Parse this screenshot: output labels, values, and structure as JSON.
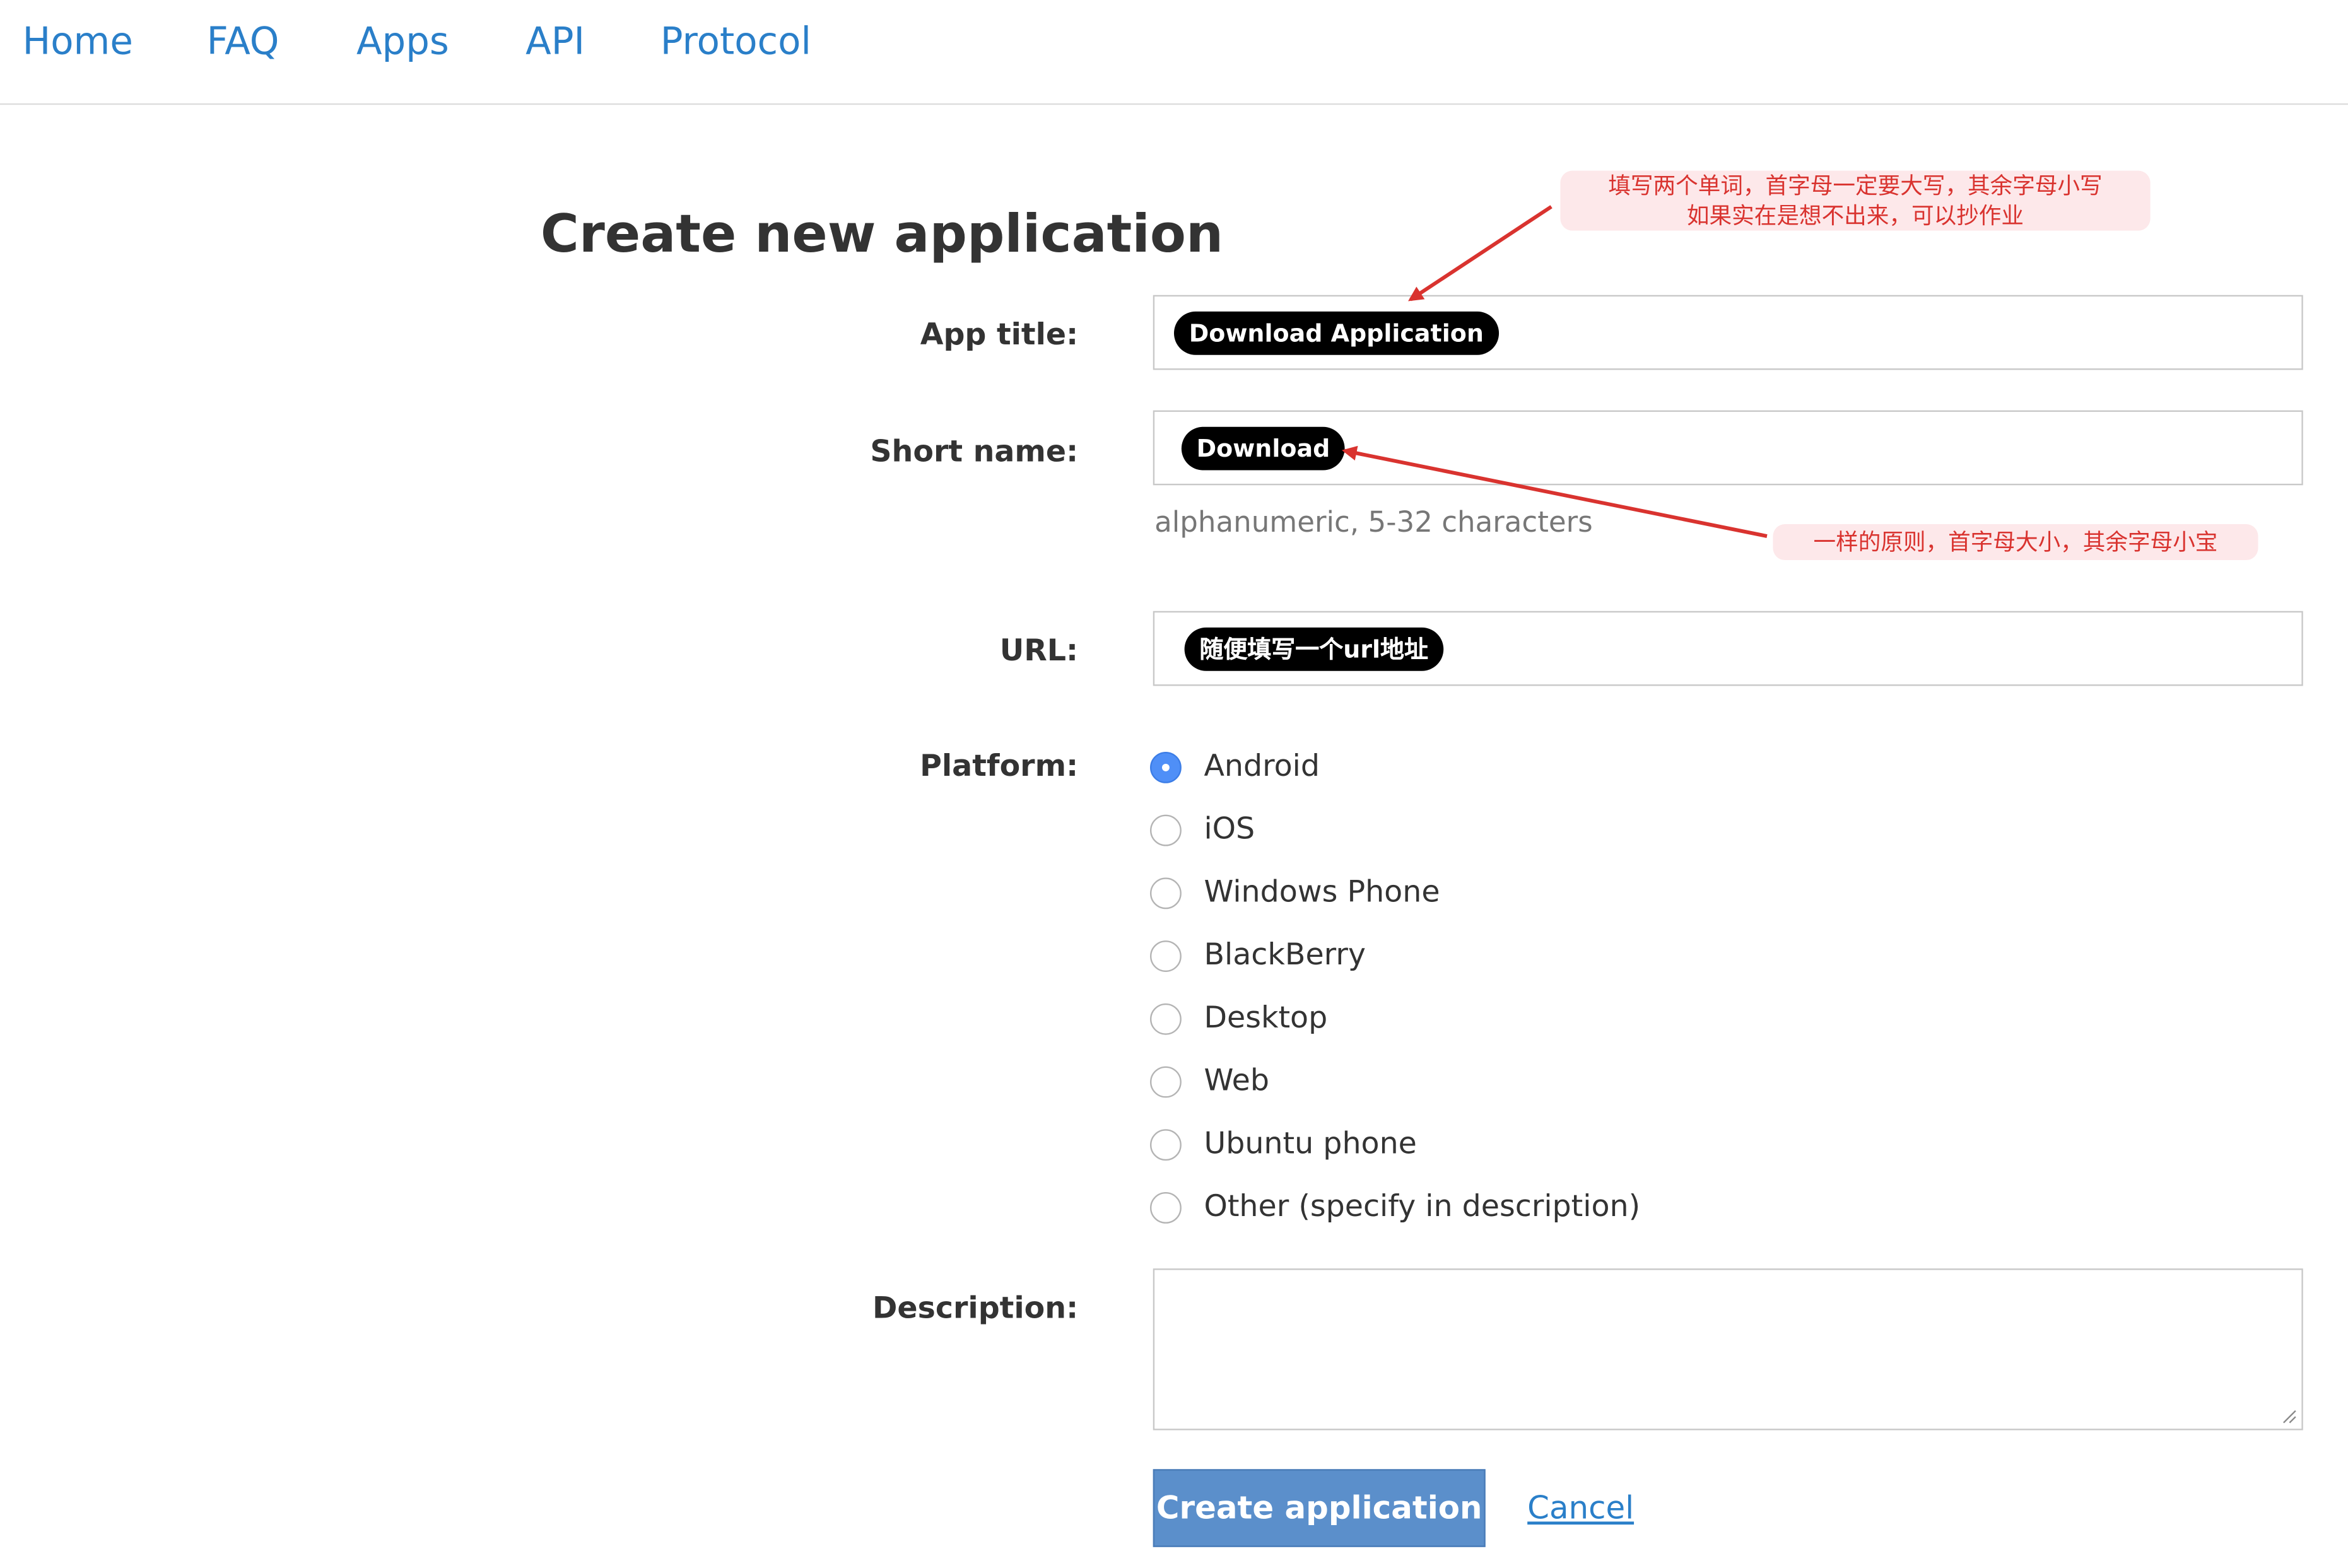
{
  "nav": {
    "items": [
      "Home",
      "FAQ",
      "Apps",
      "API",
      "Protocol"
    ]
  },
  "page": {
    "title": "Create new application"
  },
  "form": {
    "app_title": {
      "label": "App title:",
      "value": "Download Application"
    },
    "short_name": {
      "label": "Short name:",
      "value": "Download",
      "hint": "alphanumeric, 5-32 characters"
    },
    "url": {
      "label": "URL:",
      "value": "随便填写一个url地址"
    },
    "platform": {
      "label": "Platform:",
      "selected": "Android",
      "options": [
        "Android",
        "iOS",
        "Windows Phone",
        "BlackBerry",
        "Desktop",
        "Web",
        "Ubuntu phone",
        "Other (specify in description)"
      ]
    },
    "description": {
      "label": "Description:",
      "value": ""
    },
    "submit_label": "Create application",
    "cancel_label": "Cancel"
  },
  "annotations": {
    "title_note": {
      "line1": "填写两个单词，首字母一定要大写，其余字母小写",
      "line2": "如果实在是想不出来，可以抄作业"
    },
    "short_name_note": "一样的原则，首字母大小，其余字母小宝"
  },
  "colors": {
    "link": "#2a7fc9",
    "primary_button": "#5b8fcb",
    "annotation_text": "#d9332f",
    "annotation_bg": "#fde8ea",
    "radio_checked": "#4f8ff7"
  }
}
